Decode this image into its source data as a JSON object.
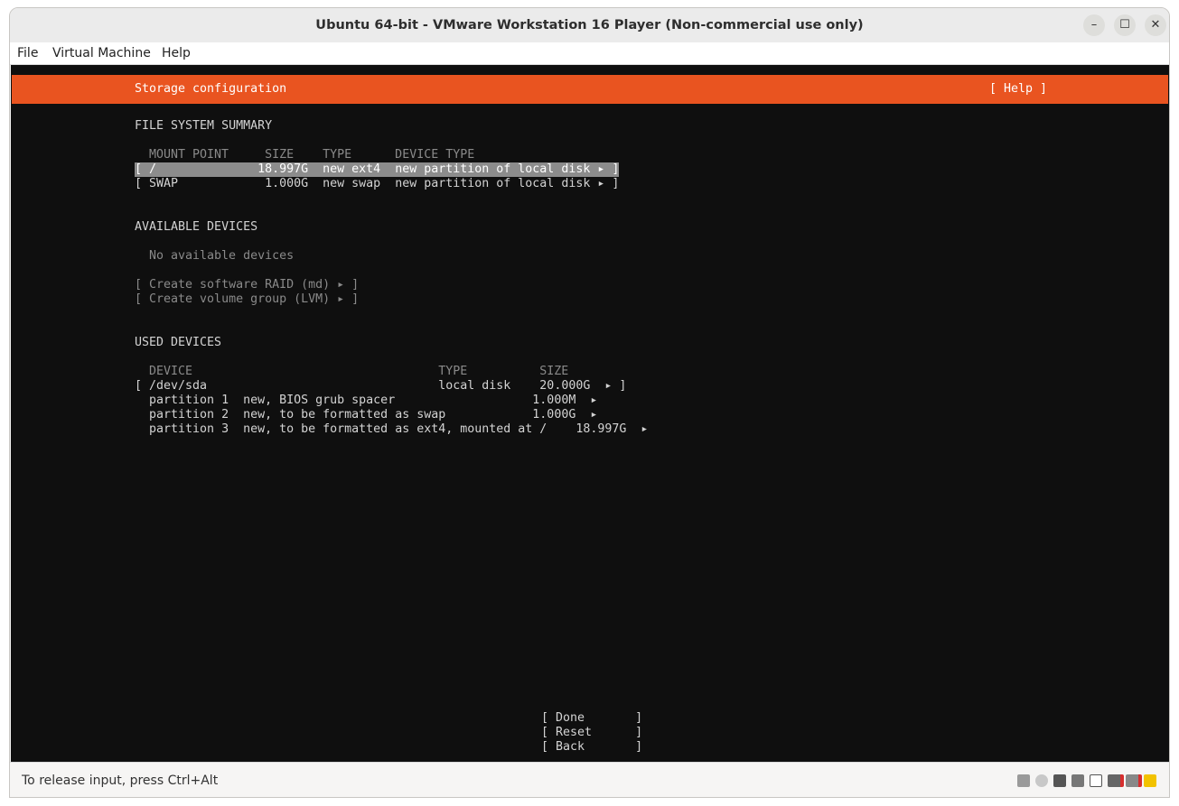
{
  "window": {
    "title": "Ubuntu 64-bit - VMware Workstation 16 Player (Non-commercial use only)"
  },
  "menu": {
    "file": "File",
    "vm": "Virtual Machine",
    "help": "Help"
  },
  "console": {
    "header_title": "Storage configuration",
    "header_help": "[ Help ]",
    "fs_summary": {
      "heading": "FILE SYSTEM SUMMARY",
      "columns": "MOUNT POINT     SIZE    TYPE      DEVICE TYPE",
      "rows": [
        "[ /              18.997G  new ext4  new partition of local disk ▸ ]",
        "[ SWAP            1.000G  new swap  new partition of local disk ▸ ]"
      ]
    },
    "available": {
      "heading": "AVAILABLE DEVICES",
      "empty": "No available devices",
      "raid": "[ Create software RAID (md) ▸ ]",
      "lvm": "[ Create volume group (LVM) ▸ ]"
    },
    "used": {
      "heading": "USED DEVICES",
      "columns": "DEVICE                                  TYPE          SIZE",
      "rows": [
        "[ /dev/sda                                local disk    20.000G  ▸ ]",
        "  partition 1  new, BIOS grub spacer                   1.000M  ▸",
        "  partition 2  new, to be formatted as swap            1.000G  ▸",
        "  partition 3  new, to be formatted as ext4, mounted at /    18.997G  ▸"
      ]
    },
    "actions": {
      "done": "[ Done       ]",
      "reset": "[ Reset      ]",
      "back": "[ Back       ]"
    }
  },
  "status": {
    "text": "To release input, press Ctrl+Alt"
  },
  "colors": {
    "accent": "#e95420",
    "console_bg": "#0f0f0f",
    "selection": "#8c8c8c"
  },
  "status_icons": [
    "hard-disk-icon",
    "cd-icon",
    "network-icon",
    "printer-icon",
    "sound-icon",
    "usb-disconnected-icon",
    "display-disconnected-icon",
    "message-icon"
  ]
}
